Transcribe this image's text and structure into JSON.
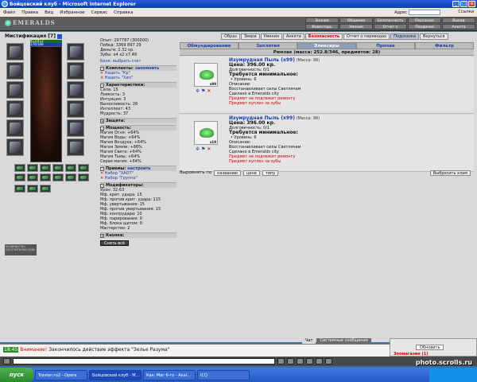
{
  "window": {
    "title": "Бойцовский клуб - Microsoft Internet Explorer"
  },
  "menu": [
    "Файл",
    "Правка",
    "Вид",
    "Избранное",
    "Сервис",
    "Справка"
  ],
  "address_label": "Адрес",
  "links_label": "Ссылки",
  "logo": "EMERALDS",
  "top_nav": [
    "Знания",
    "Общение",
    "Безопасность",
    "Персонаж",
    "Выход",
    "Инвентарь",
    "Умения",
    "Отчет о переводах",
    "Поединки",
    "Анкета"
  ],
  "character": {
    "name": "Мистификация",
    "level": "[7]",
    "hp": "412/412",
    "mp": "176/188"
  },
  "stats": {
    "exp": "Опыт: 297787 (300000)",
    "wins": "Побед: 3369   897   29",
    "money": "Деньги: 2.32 кр.",
    "teeth": "Зубы: x4 x2 x7.48",
    "bank": "Банк: выбрать счет",
    "sets_label": "Комплекты:",
    "sets_action": "запомнить",
    "set1": "Надеть \"Кр\"",
    "set2": "Надеть \"Хил\"",
    "char_label": "Характеристики:",
    "str": "Сила: 15",
    "agi": "Ловкость: 3",
    "int": "Интуиция: 3",
    "end": "Выносливость: 26",
    "intel": "Интеллект: 43",
    "wis": "Мудрость: 37",
    "prot_label": "Защита:",
    "power_label": "Мощность:",
    "m1": "Магия Огня: +64%",
    "m2": "Магия Воды: +64%",
    "m3": "Магия Воздуха: +64%",
    "m4": "Магия Земли: +66%",
    "m5": "Магия Света: +64%",
    "m6": "Магия Тьмы: +64%",
    "m7": "Серая магия: +64%",
    "tricks_label": "Приемы:",
    "tricks_action": "настроить",
    "t1": "Набор \"ХАОТ\"",
    "t2": "Набор \"Группа\"",
    "mods_label": "Модификаторы:",
    "d1": "Урон: 32-63",
    "d2": "Мф. крит. удара: 15",
    "d3": "Мф. против крит. удара: 115",
    "d4": "Мф. увертывания: 15",
    "d5": "Мф. против увертывания: 15",
    "d6": "Мф. контрудара: 10",
    "d7": "Мф. парирования: 0",
    "d8": "Мф. блока щитом: 0",
    "d9": "Мастерство: 2",
    "buttons_label": "Кнопки:",
    "undress": "Снять всё"
  },
  "counter": "КОЛИЧЕСТВО ПОСЕТИТЕЛЕЙ 2046",
  "panel": {
    "buttons": [
      "Образ",
      "Звери",
      "Умения",
      "Анкета",
      "Безопасность",
      "Отчет о переводах",
      "Подсказка",
      "Вернуться"
    ],
    "tabs": [
      "Обмундирование",
      "Заклятия",
      "Эликсиры",
      "Прочее",
      "Фильтр"
    ],
    "backpack": "Рюкзак (масса: 252.8/346, предметов: 28)",
    "items": [
      {
        "name": "Изумрудная Пыль (x99)",
        "mass": "(Масса: 99)",
        "price": "Цена: 396.00 кр.",
        "durability": "Долговечность: 0/1",
        "req": "Требуется минимальное:",
        "level": "• Уровень: 6",
        "desc_label": "Описание:",
        "desc": "Восстанавливает силы Светлячам",
        "made": "Сделано в Emeralds city",
        "note1": "Предмет не подлежит ремонту",
        "note2": "Предмет куплен за зубы",
        "count": "x99"
      },
      {
        "name": "Изумрудная Пыль (x99)",
        "mass": "(Масса: 99)",
        "price": "Цена: 396.00 кр.",
        "durability": "Долговечность: 0/1",
        "req": "Требуется минимальное:",
        "level": "• Уровень: 6",
        "desc_label": "Описание:",
        "desc": "Восстанавливает силы Светлячам",
        "made": "Сделано в Emeralds city",
        "note1": "Предмет не подлежит ремонту",
        "note2": "Предмет куплен за зубы",
        "count": "x19"
      }
    ],
    "sort_label": "Выровнять по",
    "sort": [
      "названию",
      "цене",
      "типу"
    ],
    "choose": "Выбросить хлам"
  },
  "chat": {
    "tabs": [
      "Чат",
      "Системные сообщения"
    ],
    "time": "18:45",
    "warn": "Внимание!",
    "message": "Закончилось действие эффекта \"Зелье Разума\""
  },
  "zoo": {
    "refresh": "Обновить",
    "title": "Зоомагазин (1)"
  },
  "watermark": "photo.scrolls.ru",
  "taskbar": {
    "start": "пуск",
    "tasks": [
      "Travian.ru2 - Opera",
      "Бойцовский клуб - M...",
      "Как: Маг 6-го - Акаl...",
      "ICQ"
    ]
  }
}
